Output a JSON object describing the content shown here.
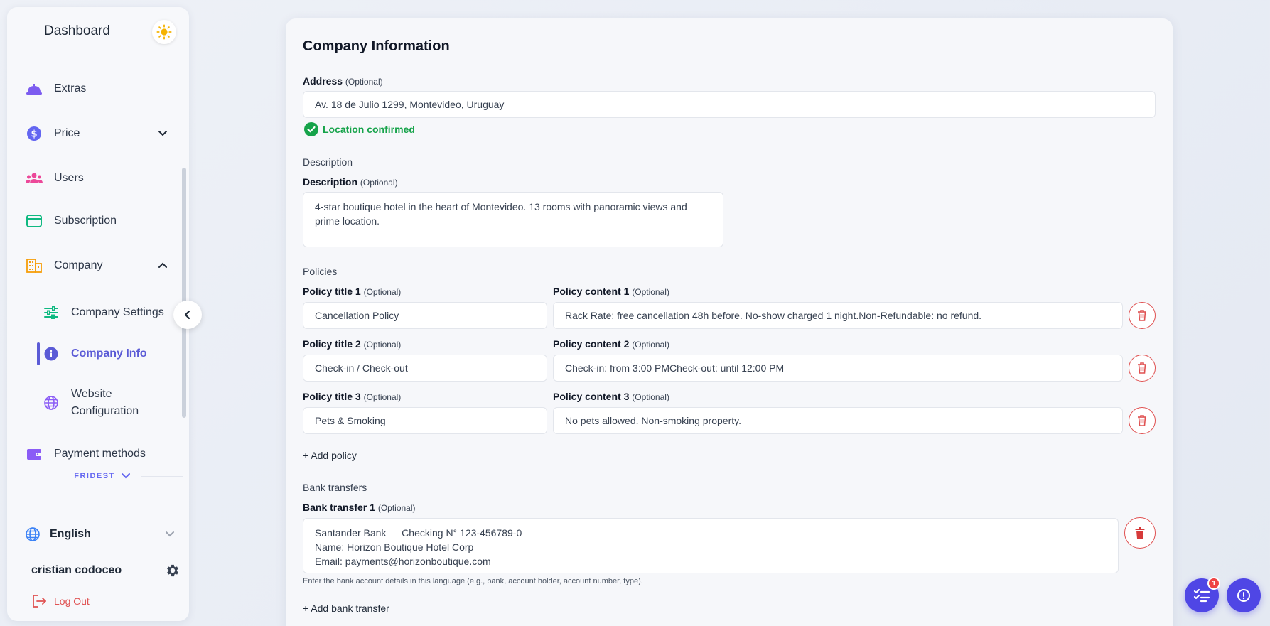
{
  "sidebar": {
    "title": "Dashboard",
    "theme_icon": "sun-icon",
    "items": [
      {
        "label": "Extras",
        "icon": "cloche-icon",
        "color": "#7c5cf0"
      },
      {
        "label": "Price",
        "icon": "dollar-icon",
        "color": "#6366f1"
      },
      {
        "label": "Users",
        "icon": "users-icon",
        "color": "#ec4899"
      },
      {
        "label": "Subscription",
        "icon": "credit-card-icon",
        "color": "#10b981"
      },
      {
        "label": "Company",
        "icon": "building-icon",
        "color": "#f59e0b"
      },
      {
        "label": "Payment methods",
        "icon": "wallet-icon",
        "color": "#8b5cf6"
      }
    ],
    "company_sub": [
      {
        "label": "Company Settings",
        "icon": "sliders-icon"
      },
      {
        "label": "Company Info",
        "icon": "info-icon"
      },
      {
        "label": "Website Configuration",
        "icon": "globe-icon"
      }
    ],
    "workspace": "FRIDEST",
    "language": "English",
    "user_name": "cristian codoceo",
    "logout": "Log Out",
    "accent": "#5b5bd6"
  },
  "main": {
    "title": "Company Information",
    "address": {
      "label": "Address",
      "optional": "(Optional)",
      "value": "Av. 18 de Julio 1299, Montevideo, Uruguay",
      "status": "Location confirmed"
    },
    "description": {
      "section": "Description",
      "label": "Description",
      "optional": "(Optional)",
      "value": "4-star boutique hotel in the heart of Montevideo. 13 rooms with panoramic views and prime location."
    },
    "policies": {
      "section": "Policies",
      "items": [
        {
          "title_label": "Policy title 1",
          "content_label": "Policy content 1",
          "title": "Cancellation Policy",
          "content": "Rack Rate: free cancellation 48h before. No-show charged 1 night.Non-Refundable: no refund."
        },
        {
          "title_label": "Policy title 2",
          "content_label": "Policy content 2",
          "title": "Check-in / Check-out",
          "content": "Check-in: from 3:00 PMCheck-out: until 12:00 PM"
        },
        {
          "title_label": "Policy title 3",
          "content_label": "Policy content 3",
          "title": "Pets & Smoking",
          "content": "No pets allowed. Non-smoking property."
        }
      ],
      "optional": "(Optional)",
      "add_label": "+ Add policy"
    },
    "bank": {
      "section": "Bank transfers",
      "label": "Bank transfer 1",
      "optional": "(Optional)",
      "lines": [
        "Santander Bank — Checking N° 123-456789-0",
        "Name: Horizon Boutique Hotel Corp",
        "Email: payments@horizonboutique.com"
      ],
      "hint": "Enter the bank account details in this language (e.g., bank, account holder, account number, type).",
      "add_label": "+ Add bank transfer"
    }
  },
  "fab": {
    "tasks_badge": "1",
    "tasks_icon": "checklist-icon",
    "help_icon": "alert-circle-icon"
  }
}
